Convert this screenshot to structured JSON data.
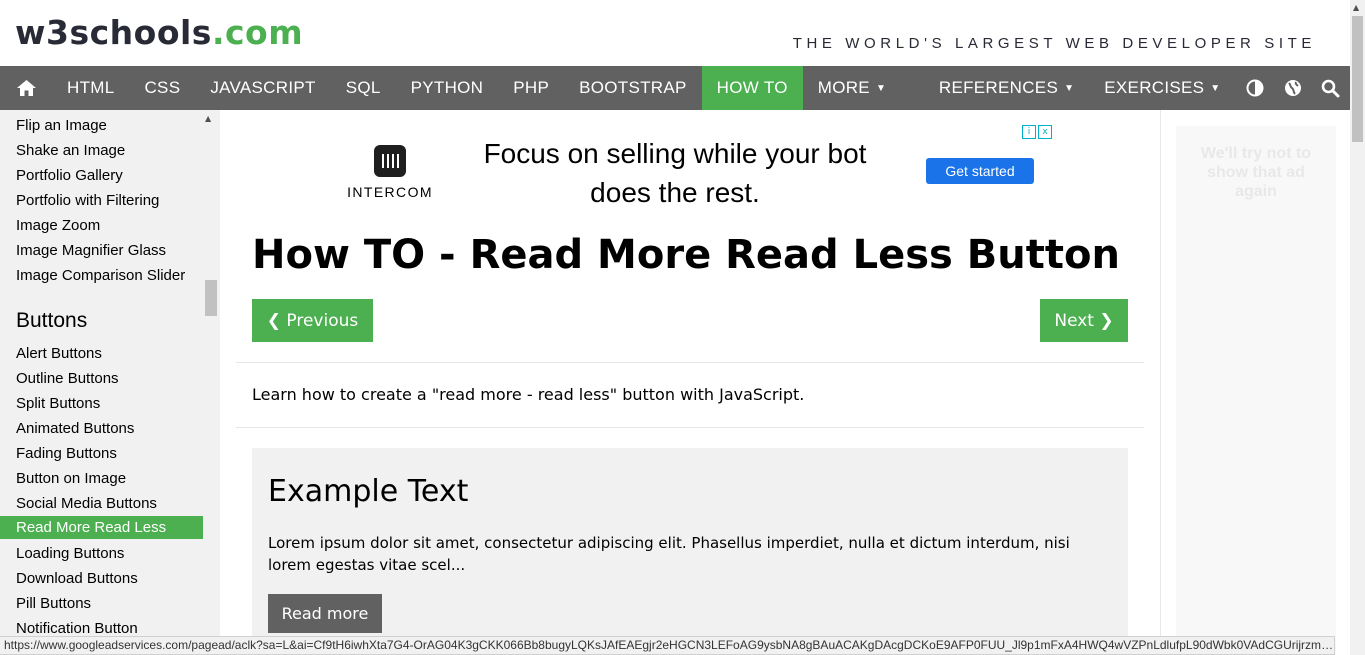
{
  "header": {
    "logo_main": "w3schools",
    "logo_tld": ".com",
    "tagline": "THE WORLD'S LARGEST WEB DEVELOPER SITE"
  },
  "nav": {
    "items": [
      {
        "label": "HTML"
      },
      {
        "label": "CSS"
      },
      {
        "label": "JAVASCRIPT"
      },
      {
        "label": "SQL"
      },
      {
        "label": "PYTHON"
      },
      {
        "label": "PHP"
      },
      {
        "label": "BOOTSTRAP"
      },
      {
        "label": "HOW TO",
        "active": true
      },
      {
        "label": "MORE",
        "caret": true
      }
    ],
    "right_items": [
      {
        "label": "REFERENCES",
        "caret": true
      },
      {
        "label": "EXERCISES",
        "caret": true
      }
    ],
    "icons": [
      "home-icon",
      "contrast-icon",
      "globe-icon",
      "search-icon"
    ]
  },
  "sidebar": {
    "image_links": [
      "Flip an Image",
      "Shake an Image",
      "Portfolio Gallery",
      "Portfolio with Filtering",
      "Image Zoom",
      "Image Magnifier Glass",
      "Image Comparison Slider"
    ],
    "buttons_heading": "Buttons",
    "button_links": [
      "Alert Buttons",
      "Outline Buttons",
      "Split Buttons",
      "Animated Buttons",
      "Fading Buttons",
      "Button on Image",
      "Social Media Buttons",
      "Read More Read Less",
      "Loading Buttons",
      "Download Buttons",
      "Pill Buttons",
      "Notification Button"
    ],
    "active_link": "Read More Read Less"
  },
  "ad": {
    "brand": "INTERCOM",
    "headline": "Focus on selling while your bot does the rest.",
    "cta": "Get started",
    "choices_info": "i",
    "choices_close": "x"
  },
  "main": {
    "title": "How TO - Read More Read Less Button",
    "prev_label": "❮ Previous",
    "next_label": "Next ❯",
    "intro": "Learn how to create a \"read more - read less\" button with JavaScript.",
    "example": {
      "title": "Example Text",
      "body": "Lorem ipsum dolor sit amet, consectetur adipiscing elit. Phasellus imperdiet, nulla et dictum interdum, nisi lorem egestas vitae scel...",
      "button": "Read more"
    }
  },
  "right_ad": {
    "text": "We'll try not to show that ad again"
  },
  "statusbar": {
    "url": "https://www.googleadservices.com/pagead/aclk?sa=L&ai=Cf9tH6iwhXta7G4-OrAG04K3gCKK066Bb8bugyLQKsJAfEAEgjr2eHGCN3LEFoAG9ysbNA8gBAuACAKgDAcgDCKoE9AFP0FUU_Jl9p1mFxA4HWQ4wVZPnLdlufpL90dWbk0VAdCGUrijrzmeppumiG..."
  },
  "colors": {
    "brand_green": "#4caf50",
    "nav_bg": "#616161",
    "sidebar_bg": "#f1f1f1",
    "ad_button": "#1a73e8"
  }
}
